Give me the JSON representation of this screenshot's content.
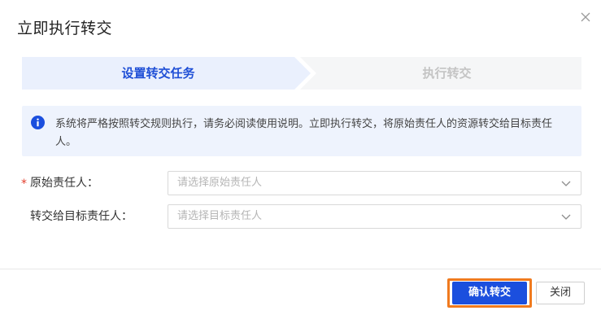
{
  "dialog": {
    "title": "立即执行转交",
    "close_icon": "close-icon"
  },
  "steps": [
    {
      "label": "设置转交任务",
      "state": "active"
    },
    {
      "label": "执行转交",
      "state": "inactive"
    }
  ],
  "notice": {
    "icon": "info-icon",
    "text": "系统将严格按照转交规则执行，请务必阅读使用说明。立即执行转交，将原始责任人的资源转交给目标责任人。"
  },
  "form": {
    "original_owner": {
      "required_mark": "*",
      "label": "原始责任人：",
      "placeholder": "请选择原始责任人"
    },
    "target_owner": {
      "label": "转交给目标责任人：",
      "placeholder": "请选择目标责任人"
    }
  },
  "footer": {
    "confirm_label": "确认转交",
    "close_label": "关闭"
  },
  "colors": {
    "primary": "#1b4fde",
    "highlight_outline": "#f07a1e",
    "step_active_bg": "#eaf0fd",
    "step_inactive_bg": "#f5f6f7",
    "required": "#e23c2a"
  }
}
